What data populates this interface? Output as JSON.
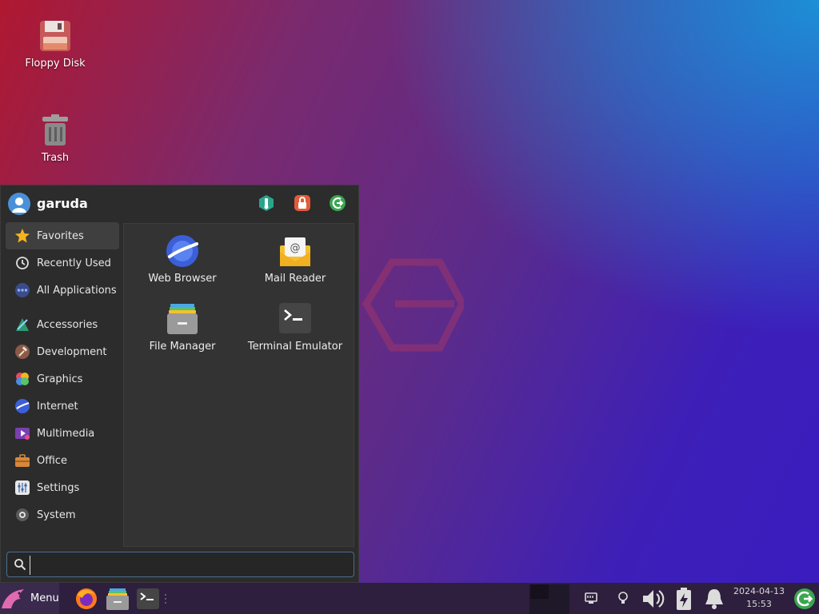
{
  "desktop": {
    "icons": [
      {
        "label": "Floppy Disk"
      },
      {
        "label": "Trash"
      }
    ]
  },
  "menu": {
    "user": "garuda",
    "header_buttons": [
      "settings-manager-icon",
      "lock-screen-icon",
      "log-out-icon"
    ],
    "categories": [
      {
        "label": "Favorites",
        "icon": "star-icon"
      },
      {
        "label": "Recently Used",
        "icon": "clock-icon"
      },
      {
        "label": "All Applications",
        "icon": "dots-icon"
      },
      {
        "label": "Accessories",
        "icon": "accessories-icon"
      },
      {
        "label": "Development",
        "icon": "hammer-icon"
      },
      {
        "label": "Graphics",
        "icon": "palette-icon"
      },
      {
        "label": "Internet",
        "icon": "globe-icon"
      },
      {
        "label": "Multimedia",
        "icon": "media-icon"
      },
      {
        "label": "Office",
        "icon": "briefcase-icon"
      },
      {
        "label": "Settings",
        "icon": "sliders-icon"
      },
      {
        "label": "System",
        "icon": "gear-icon"
      }
    ],
    "apps": [
      {
        "label": "Web Browser"
      },
      {
        "label": "Mail Reader"
      },
      {
        "label": "File Manager"
      },
      {
        "label": "Terminal Emulator"
      }
    ],
    "search": {
      "value": "",
      "placeholder": ""
    }
  },
  "taskbar": {
    "menu_label": "Menu",
    "clock": {
      "date": "2024-04-13",
      "time": "15:53"
    }
  },
  "colors": {
    "accent": "#4a90d9",
    "panel": "#2c2c2c",
    "taskbar": "#2d1f3d"
  }
}
